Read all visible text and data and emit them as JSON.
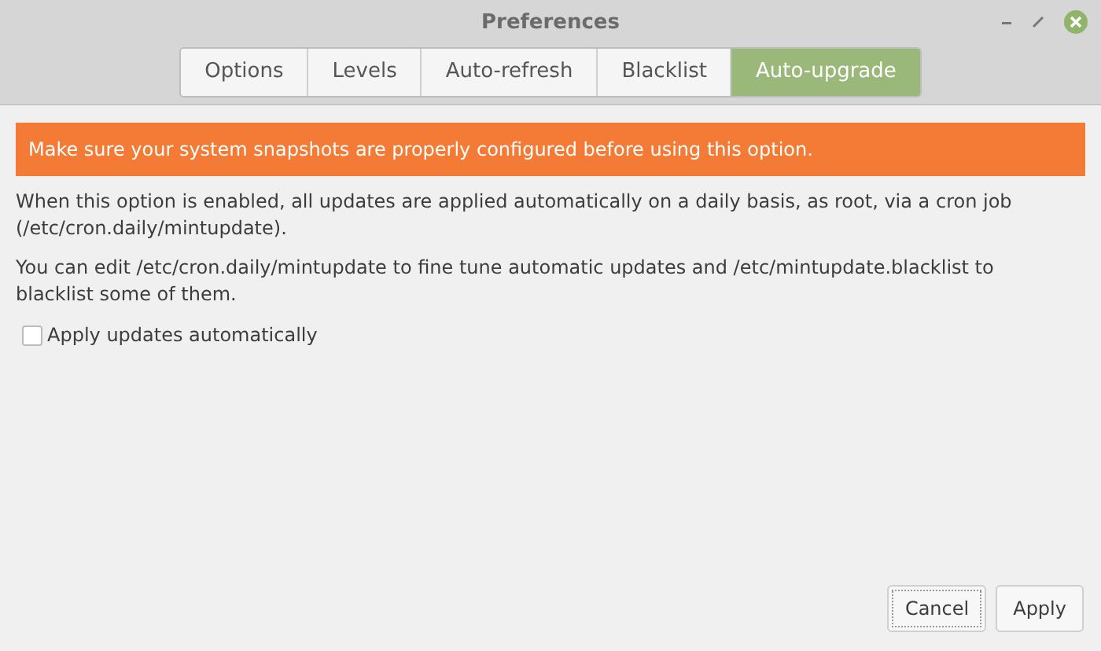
{
  "window": {
    "title": "Preferences"
  },
  "tabs": [
    {
      "label": "Options",
      "selected": false
    },
    {
      "label": "Levels",
      "selected": false
    },
    {
      "label": "Auto-refresh",
      "selected": false
    },
    {
      "label": "Blacklist",
      "selected": false
    },
    {
      "label": "Auto-upgrade",
      "selected": true
    }
  ],
  "warning": "Make sure your system snapshots are properly configured before using this option.",
  "paragraphs": [
    "When this option is enabled, all updates are applied automatically on a daily basis, as root, via a cron job (/etc/cron.daily/mintupdate).",
    "You can edit /etc/cron.daily/mintupdate to fine tune automatic updates and /etc/mintupdate.blacklist to blacklist some of them."
  ],
  "checkbox": {
    "label": "Apply updates automatically",
    "checked": false
  },
  "buttons": [
    {
      "label": "Cancel",
      "focused": true
    },
    {
      "label": "Apply",
      "focused": false
    }
  ]
}
